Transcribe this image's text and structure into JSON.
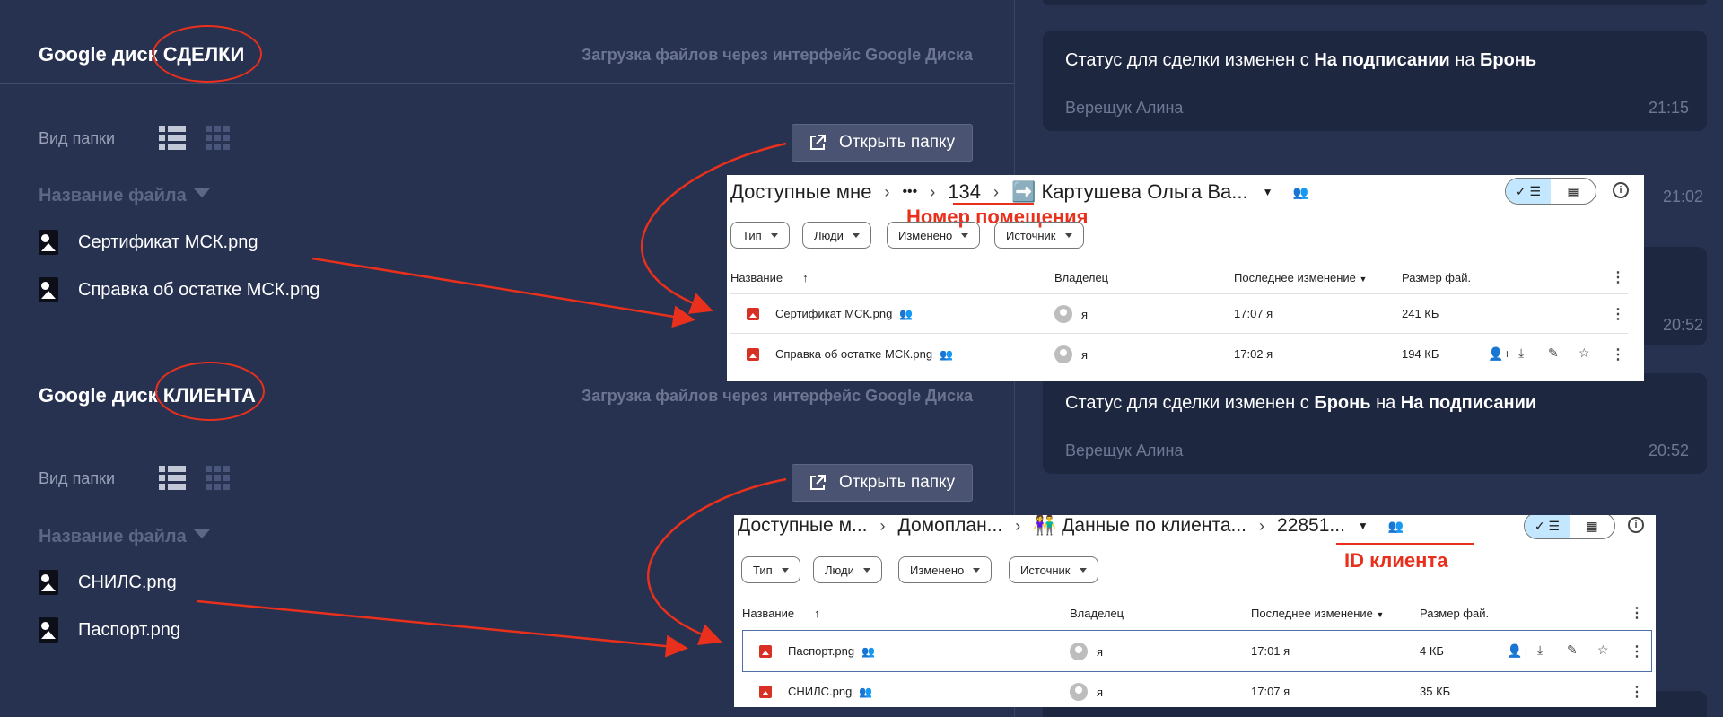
{
  "deals_section": {
    "title_prefix": "Google диск ",
    "title_highlight": "СДЕЛКИ",
    "subtitle": "Загрузка файлов через интерфейс Google Диска",
    "view_label": "Вид папки",
    "open_folder_label": "Открыть папку",
    "file_name_header": "Название файла",
    "files": [
      "Сертификат МСК.png",
      "Справка об остатке МСК.png"
    ]
  },
  "client_section": {
    "title_prefix": "Google диск ",
    "title_highlight": "КЛИЕНТА",
    "subtitle": "Загрузка файлов через интерфейс Google Диска",
    "view_label": "Вид папки",
    "open_folder_label": "Открыть папку",
    "file_name_header": "Название файла",
    "files": [
      "СНИЛС.png",
      "Паспорт.png"
    ]
  },
  "activity": {
    "cards": [
      {
        "prefix": "Статус для сделки изменен с ",
        "from": "На подписании",
        "mid": " на ",
        "to": "Бронь",
        "author": "Верещук Алина",
        "time": "21:15"
      },
      {
        "prefix": "Статус для сделки изменен с ",
        "from": "Бронь",
        "mid": " на ",
        "to": "На подписании",
        "author": "Верещук Алина",
        "time": "20:52"
      }
    ],
    "faint_times": [
      "21:02",
      "20:52"
    ]
  },
  "drive_deals": {
    "breadcrumb": [
      "Доступные мне",
      "•••",
      "134",
      "➡️ Картушева Ольга Ва..."
    ],
    "annotation": "Номер помещения",
    "filters": [
      "Тип",
      "Люди",
      "Изменено",
      "Источник"
    ],
    "columns": {
      "name": "Название",
      "owner": "Владелец",
      "modified": "Последнее изменение",
      "size": "Размер фай."
    },
    "rows": [
      {
        "name": "Сертификат МСК.png",
        "owner": "я",
        "modified": "17:07 я",
        "size": "241 КБ"
      },
      {
        "name": "Справка об остатке МСК.png",
        "owner": "я",
        "modified": "17:02 я",
        "size": "194 КБ"
      }
    ]
  },
  "drive_client": {
    "breadcrumb": [
      "Доступные м...",
      "Домоплан...",
      "👫 Данные по клиента...",
      "22851..."
    ],
    "annotation": "ID клиента",
    "filters": [
      "Тип",
      "Люди",
      "Изменено",
      "Источник"
    ],
    "columns": {
      "name": "Название",
      "owner": "Владелец",
      "modified": "Последнее изменение",
      "size": "Размер фай."
    },
    "rows": [
      {
        "name": "Паспорт.png",
        "owner": "я",
        "modified": "17:01 я",
        "size": "4 КБ"
      },
      {
        "name": "СНИЛС.png",
        "owner": "я",
        "modified": "17:07 я",
        "size": "35 КБ"
      }
    ]
  },
  "colors": {
    "accent_red": "#e8301c",
    "panel_bg": "#273150",
    "card_bg": "#1e2740"
  }
}
